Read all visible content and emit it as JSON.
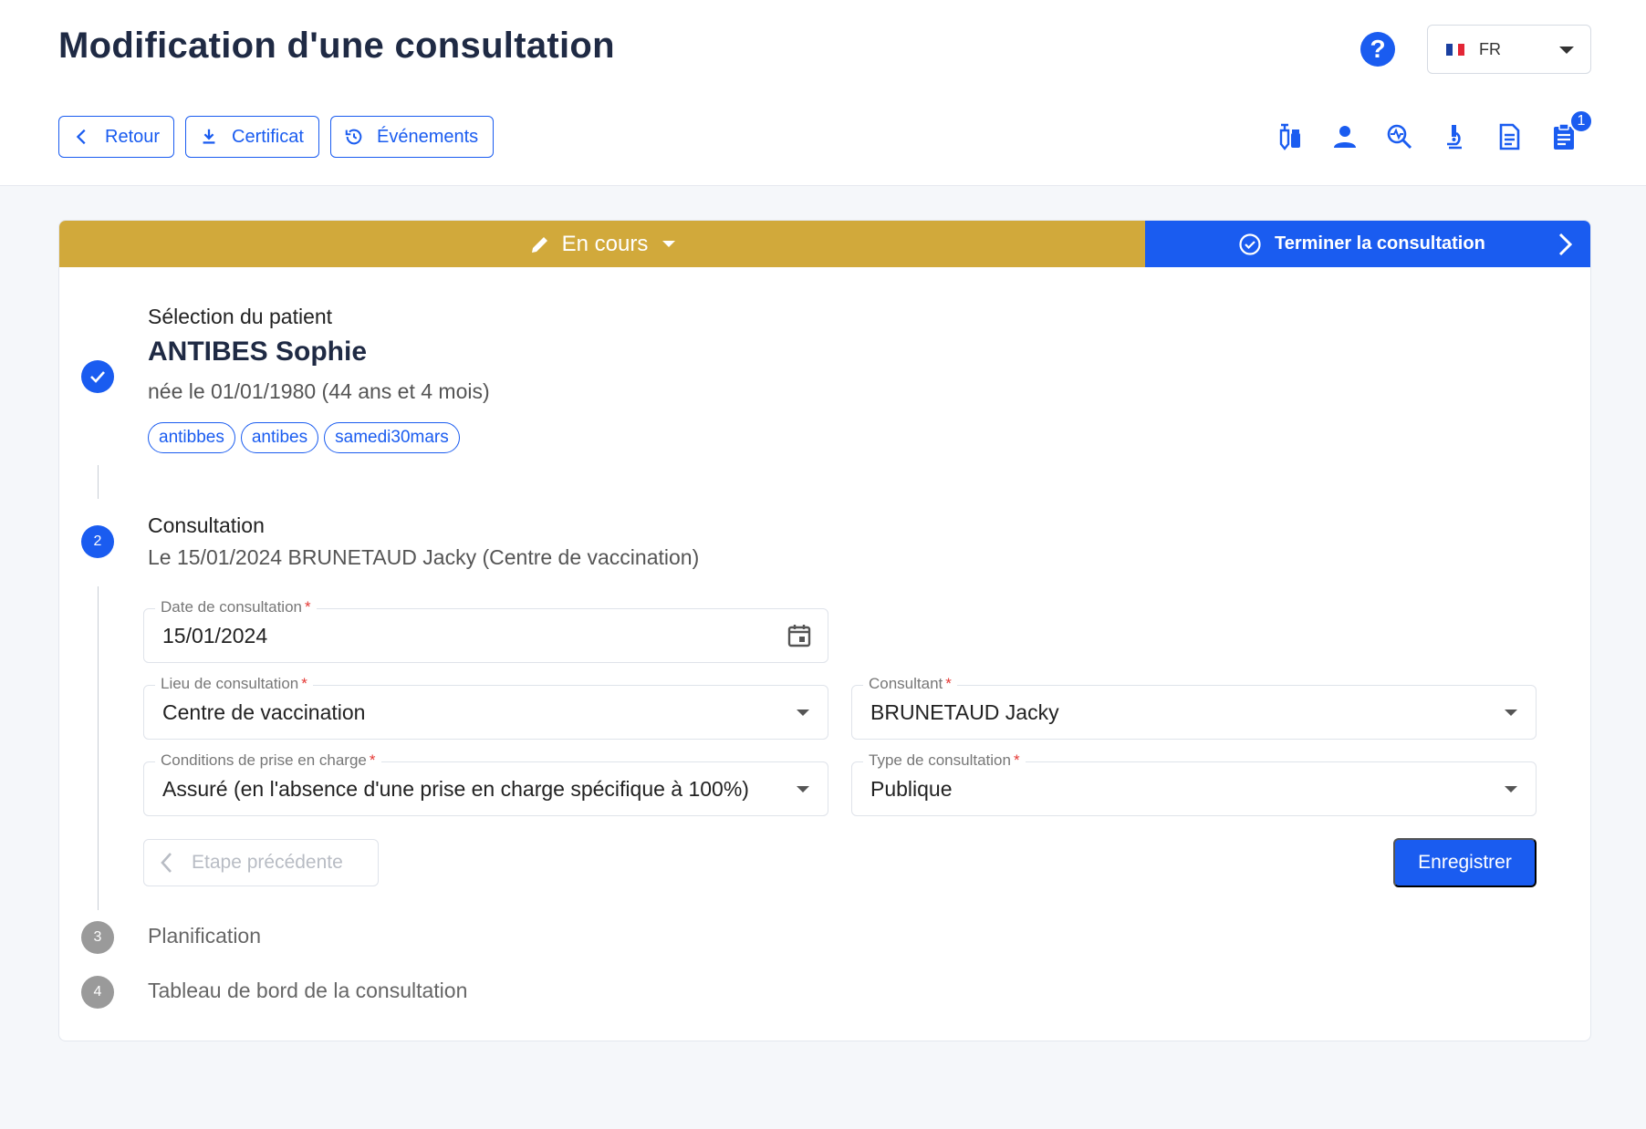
{
  "header": {
    "title": "Modification d'une consultation",
    "help_label": "?",
    "language": {
      "flag": "fr-flag-icon",
      "label": "FR"
    }
  },
  "toolbar": {
    "back_label": "Retour",
    "certificate_label": "Certificat",
    "events_label": "Événements",
    "tools": [
      "vaccine-vial-icon",
      "person-icon",
      "search-health-icon",
      "microscope-icon",
      "document-icon",
      "clipboard-icon"
    ],
    "clipboard_badge": "1"
  },
  "status": {
    "label": "En cours",
    "status_color": "#d1a93b",
    "finish_label": "Terminer la consultation",
    "accent_color": "#1a5cf0"
  },
  "steps": {
    "patient": {
      "title": "Sélection du patient",
      "name": "ANTIBES Sophie",
      "dob": "née le 01/01/1980 (44 ans et 4 mois)",
      "tags": [
        "antibbes",
        "antibes",
        "samedi30mars"
      ]
    },
    "consultation": {
      "number": "2",
      "title": "Consultation",
      "summary": "Le 15/01/2024 BRUNETAUD Jacky (Centre de vaccination)",
      "fields": {
        "date": {
          "label": "Date de consultation",
          "value": "15/01/2024"
        },
        "lieu": {
          "label": "Lieu de consultation",
          "value": "Centre de vaccination"
        },
        "consultant": {
          "label": "Consultant",
          "value": "BRUNETAUD Jacky"
        },
        "conditions": {
          "label": "Conditions de prise en charge",
          "value": "Assuré (en l'absence d'une prise en charge spécifique à 100%)"
        },
        "type": {
          "label": "Type de consultation",
          "value": "Publique"
        }
      },
      "required_mark": "*",
      "prev_label": "Etape précédente",
      "save_label": "Enregistrer"
    },
    "planification": {
      "number": "3",
      "title": "Planification"
    },
    "dashboard": {
      "number": "4",
      "title": "Tableau de bord de la consultation"
    }
  }
}
